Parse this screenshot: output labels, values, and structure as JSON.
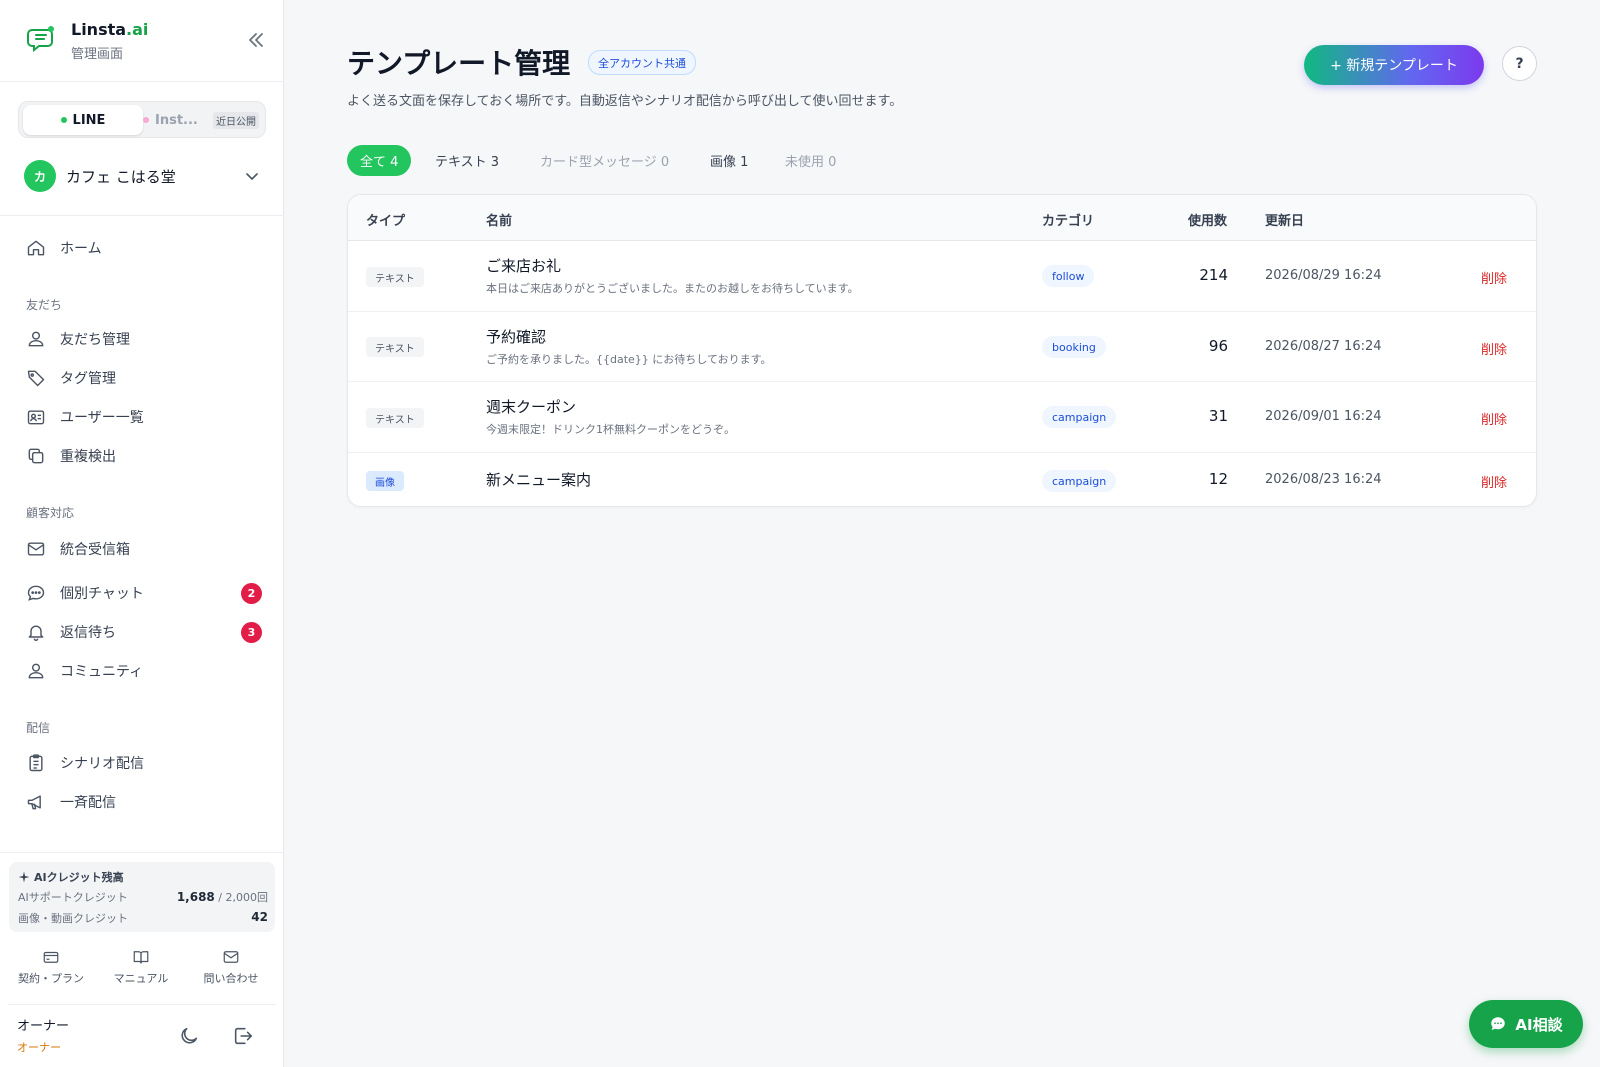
{
  "brand": {
    "name": "Linsta",
    "name_accent": ".ai",
    "subtitle": "管理画面"
  },
  "channels": {
    "line_label": "LINE",
    "instagram_label": "Inst...",
    "soon_label": "近日公開",
    "line_color": "#22c55e",
    "instagram_color": "#f9a8d4"
  },
  "account": {
    "avatar_initial": "カ",
    "name": "カフェ こはる堂"
  },
  "nav": {
    "home": "ホーム",
    "section_friends": "友だち",
    "friends_manage": "友だち管理",
    "tag_manage": "タグ管理",
    "user_list": "ユーザー一覧",
    "duplicate": "重複検出",
    "section_support": "顧客対応",
    "inbox": "統合受信箱",
    "chat": "個別チャット",
    "chat_badge": "2",
    "awaiting": "返信待ち",
    "awaiting_badge": "3",
    "community": "コミュニティ",
    "section_delivery": "配信",
    "scenario": "シナリオ配信",
    "broadcast": "一斉配信"
  },
  "credits": {
    "title": "AIクレジット残高",
    "support_label": "AIサポートクレジット",
    "support_value": "1,688",
    "support_total": "/ 2,000回",
    "media_label": "画像・動画クレジット",
    "media_value": "42"
  },
  "footer": {
    "plan": "契約・プラン",
    "manual": "マニュアル",
    "contact": "問い合わせ"
  },
  "user": {
    "name": "オーナー",
    "role": "オーナー"
  },
  "header": {
    "title": "テンプレート管理",
    "scope_badge": "全アカウント共通",
    "description": "よく送る文面を保存しておく場所です。自動返信やシナリオ配信から呼び出して使い回せます。",
    "new_button": "+ 新規テンプレート",
    "help": "?"
  },
  "filters": [
    {
      "label": "全て 4",
      "state": "active"
    },
    {
      "label": "テキスト 3",
      "state": "normal"
    },
    {
      "label": "カード型メッセージ 0",
      "state": "dim"
    },
    {
      "label": "画像 1",
      "state": "normal"
    },
    {
      "label": "未使用 0",
      "state": "dim"
    }
  ],
  "table": {
    "columns": {
      "type": "タイプ",
      "name": "名前",
      "category": "カテゴリ",
      "usage": "使用数",
      "updated": "更新日"
    },
    "rows": [
      {
        "type": "テキスト",
        "name": "ご来店お礼",
        "desc": "本日はご来店ありがとうございました。またのお越しをお待ちしています。",
        "category": "follow",
        "usage": "214",
        "updated": "2026/08/29 16:24",
        "action": "削除"
      },
      {
        "type": "テキスト",
        "name": "予約確認",
        "desc": "ご予約を承りました。{{date}} にお待ちしております。",
        "category": "booking",
        "usage": "96",
        "updated": "2026/08/27 16:24",
        "action": "削除"
      },
      {
        "type": "テキスト",
        "name": "週末クーポン",
        "desc": "今週末限定！ドリンク1杯無料クーポンをどうぞ。",
        "category": "campaign",
        "usage": "31",
        "updated": "2026/09/01 16:24",
        "action": "削除"
      },
      {
        "type": "画像",
        "name": "新メニュー案内",
        "desc": "",
        "category": "campaign",
        "usage": "12",
        "updated": "2026/08/23 16:24",
        "action": "削除"
      }
    ]
  },
  "ai_button": "AI相談"
}
